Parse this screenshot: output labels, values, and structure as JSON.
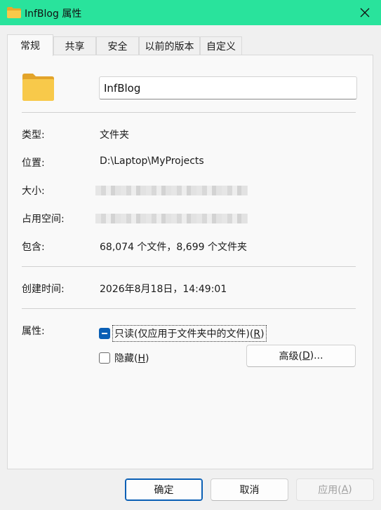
{
  "window": {
    "title": "InfBlog 属性",
    "title_color": "#29e39c"
  },
  "tabs": [
    {
      "label": "常规",
      "active": true
    },
    {
      "label": "共享",
      "active": false
    },
    {
      "label": "安全",
      "active": false
    },
    {
      "label": "以前的版本",
      "active": false
    },
    {
      "label": "自定义",
      "active": false
    }
  ],
  "general": {
    "folder_name": "InfBlog",
    "type_label": "类型:",
    "type_value": "文件夹",
    "location_label": "位置:",
    "location_value": "D:\\Laptop\\MyProjects",
    "size_label": "大小:",
    "size_on_disk_label": "占用空间:",
    "contains_label": "包含:",
    "contains_value": "68,074 个文件，8,699 个文件夹",
    "created_label": "创建时间:",
    "created_value": "2026年8月18日，14:49:01",
    "attributes_label": "属性:",
    "readonly_label_pre": "只读(仅应用于文件夹中的文件)(",
    "readonly_key": "R",
    "readonly_label_post": ")",
    "hidden_label_pre": "隐藏(",
    "hidden_key": "H",
    "hidden_label_post": ")",
    "advanced_label_pre": "高级(",
    "advanced_key": "D",
    "advanced_label_post": ")..."
  },
  "footer": {
    "ok_label": "确定",
    "cancel_label": "取消",
    "apply_label_pre": "应用(",
    "apply_key": "A",
    "apply_label_post": ")"
  },
  "icons": {
    "folder": "folder-icon",
    "close": "close-icon"
  },
  "colors": {
    "accent": "#0a5fb5",
    "folder_yellow": "#f8c94a"
  }
}
